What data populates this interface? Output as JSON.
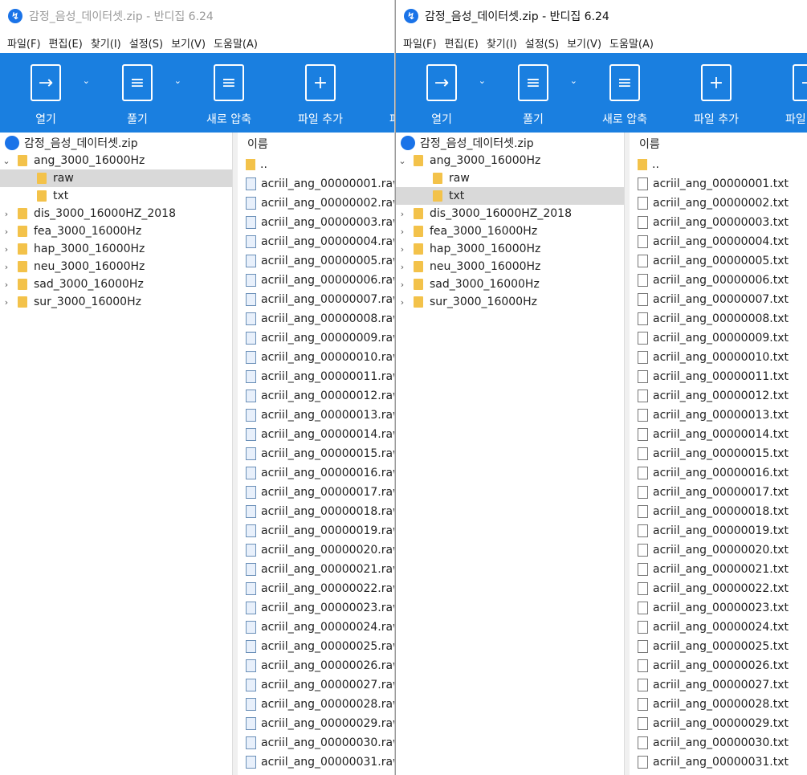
{
  "w1": {
    "title": "감정_음성_데이터셋.zip - 반디집 6.24",
    "ext": "raw",
    "selected_folder": "raw"
  },
  "w2": {
    "title": "감정_음성_데이터셋.zip - 반디집 6.24",
    "ext": "txt",
    "selected_folder": "txt"
  },
  "menu": [
    "파일(F)",
    "편집(E)",
    "찾기(I)",
    "설정(S)",
    "보기(V)",
    "도움말(A)"
  ],
  "toolbar": [
    {
      "label": "열기",
      "icon": "open-icon",
      "dd": true
    },
    {
      "label": "풀기",
      "icon": "extract-icon",
      "dd": true
    },
    {
      "label": "새로 압축",
      "icon": "compress-icon"
    },
    {
      "label": "파일 추가",
      "icon": "add-file-icon"
    },
    {
      "label": "파일 삭제",
      "icon": "delete-file-icon"
    }
  ],
  "tree": {
    "root": "감정_음성_데이터셋.zip",
    "expanded": "ang_3000_16000Hz",
    "children": [
      "raw",
      "txt"
    ],
    "folders": [
      "dis_3000_16000HZ_2018",
      "fea_3000_16000Hz",
      "hap_3000_16000Hz",
      "neu_3000_16000Hz",
      "sad_3000_16000Hz",
      "sur_3000_16000Hz"
    ]
  },
  "list": {
    "header": "이름",
    "up": "..",
    "prefix": "acriil_ang_",
    "count": 31
  }
}
